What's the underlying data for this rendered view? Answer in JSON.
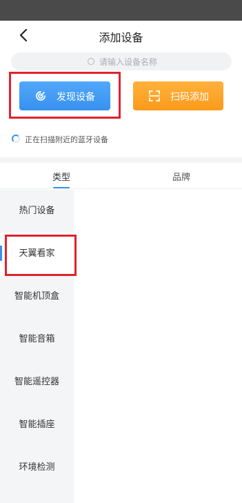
{
  "header": {
    "title": "添加设备",
    "back_icon": "chevron-left-icon"
  },
  "search": {
    "placeholder": "请输入设备名称",
    "icon": "search-icon"
  },
  "actions": {
    "discover": {
      "label": "发现设备",
      "icon": "radar-icon",
      "color": "#3791f1"
    },
    "scan": {
      "label": "扫码添加",
      "icon": "scan-frame-icon",
      "color": "#fb9a1b"
    }
  },
  "scan_status": {
    "text": "正在扫描附近的蓝牙设备"
  },
  "tabs": [
    {
      "label": "类型",
      "selected": true
    },
    {
      "label": "品牌",
      "selected": false
    }
  ],
  "categories": [
    {
      "label": "热门设备"
    },
    {
      "label": "天翼看家"
    },
    {
      "label": "智能机顶盒"
    },
    {
      "label": "智能音箱"
    },
    {
      "label": "智能遥控器"
    },
    {
      "label": "智能插座"
    },
    {
      "label": "环境检测"
    }
  ],
  "selected_category_index": 1,
  "highlight_color": "#e0212b"
}
